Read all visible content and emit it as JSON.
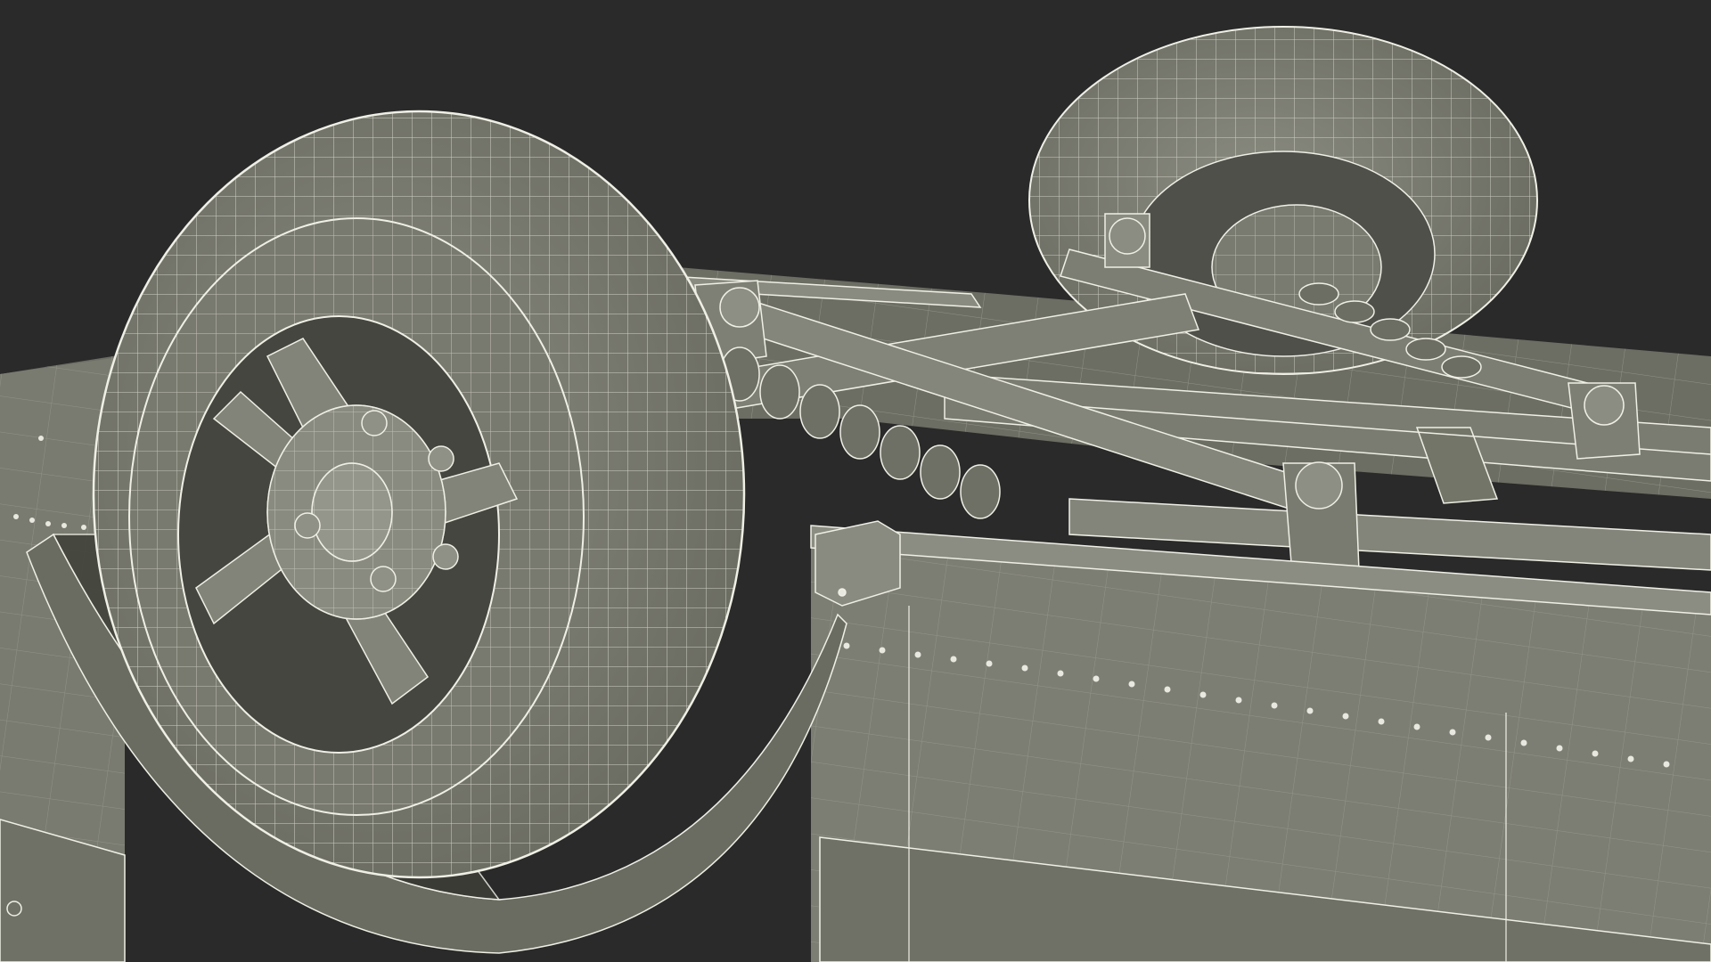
{
  "scene": {
    "subject": "wireframe-render",
    "colors": {
      "background": "#2a2a2a",
      "surface": "#7c7d72",
      "surface_light": "#8f9084",
      "surface_dark": "#5d5e55",
      "shadow": "#3d3e37",
      "wire": "#f1f1e8",
      "rivet": "#e8e8e0"
    }
  }
}
